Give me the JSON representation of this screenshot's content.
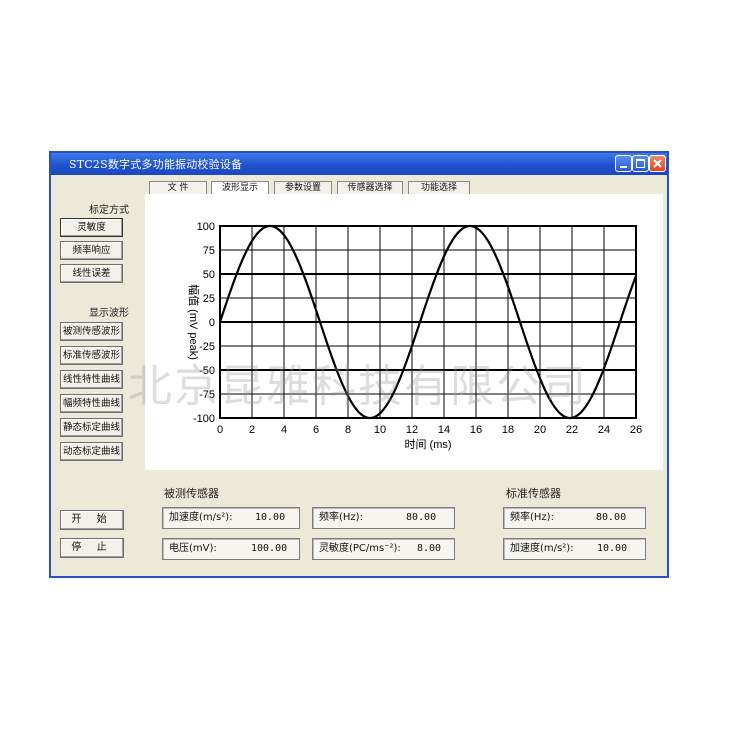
{
  "window": {
    "title": "STC2S数字式多功能振动校验设备"
  },
  "tabs": [
    {
      "label": "文 件",
      "active": false
    },
    {
      "label": "波形显示",
      "active": true
    },
    {
      "label": "参数设置",
      "active": false
    },
    {
      "label": "传感器选择",
      "active": false
    },
    {
      "label": "功能选择",
      "active": false
    }
  ],
  "sidebar": {
    "calib_mode_label": "标定方式",
    "calib_buttons": [
      "灵敏度",
      "频率响应",
      "线性误差"
    ],
    "display_label": "显示波形",
    "display_buttons": [
      "被测传感波形",
      "标准传感波形",
      "线性特性曲线",
      "幅频特性曲线",
      "静态标定曲线",
      "动态标定曲线"
    ],
    "start_label": "开 始",
    "stop_label": "停 止"
  },
  "chart_data": {
    "type": "line",
    "xlabel": "时间 (ms)",
    "ylabel": "幅值 (mV peak)",
    "xlim": [
      0,
      26
    ],
    "ylim": [
      -100,
      100
    ],
    "xticks": [
      0,
      2,
      4,
      6,
      8,
      10,
      12,
      14,
      16,
      18,
      20,
      22,
      24,
      26
    ],
    "yticks": [
      -100,
      -75,
      -50,
      -25,
      0,
      25,
      50,
      75,
      100
    ],
    "grid": true,
    "series": [
      {
        "function": "sine",
        "amplitude": 100,
        "period_ms": 12.5,
        "phase": 0,
        "x_start": 0,
        "x_end": 26,
        "color": "#000000"
      }
    ]
  },
  "measured_sensor": {
    "group_label": "被测传感器",
    "accel_label": "加速度(m/s²):",
    "accel_value": "10.00",
    "freq_label": "频率(Hz):",
    "freq_value": "80.00",
    "voltage_label": "电压(mV):",
    "voltage_value": "100.00",
    "sens_label": "灵敏度(PC/ms⁻²):",
    "sens_value": "8.00"
  },
  "standard_sensor": {
    "group_label": "标准传感器",
    "freq_label": "频率(Hz):",
    "freq_value": "80.00",
    "accel_label": "加速度(m/s²):",
    "accel_value": "10.00"
  },
  "watermark": "北京昆雅科技有限公司"
}
